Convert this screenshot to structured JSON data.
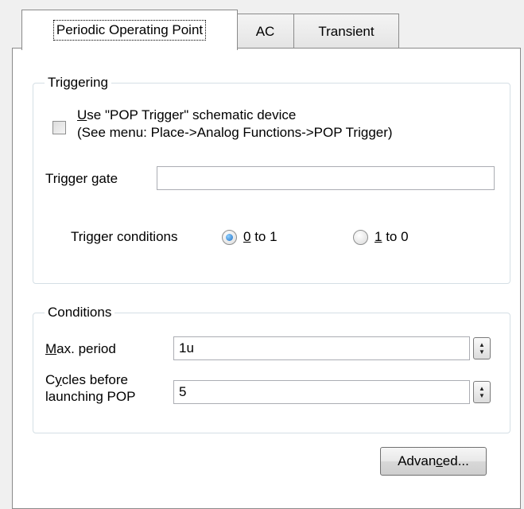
{
  "tabs": [
    {
      "label": "Periodic Operating Point",
      "active": true
    },
    {
      "label": "AC",
      "active": false
    },
    {
      "label": "Transient",
      "active": false
    }
  ],
  "triggering": {
    "title": "Triggering",
    "checkbox": {
      "checked": false,
      "label_mnemonic": "U",
      "label_rest": "se \"POP Trigger\" schematic device",
      "label_line2": "(See menu: Place->Analog Functions->POP Trigger)"
    },
    "gate": {
      "label_pre": "Trigger ",
      "label_mnemonic": "g",
      "label_post": "ate",
      "value": ""
    },
    "conditions": {
      "label": "Trigger conditions",
      "options": [
        {
          "mnemonic": "0",
          "rest": " to 1",
          "selected": true
        },
        {
          "mnemonic": "1",
          "rest": " to 0",
          "selected": false
        }
      ]
    }
  },
  "conditions": {
    "title": "Conditions",
    "max_period": {
      "label_mnemonic": "M",
      "label_rest": "ax. period",
      "value": "1u"
    },
    "cycles": {
      "label1_pre": "C",
      "label1_mnemonic": "y",
      "label1_post": "cles before",
      "label2": "launching POP",
      "value": "5"
    }
  },
  "advanced_button": {
    "label_pre": "Advan",
    "label_mnemonic": "c",
    "label_post": "ed..."
  }
}
